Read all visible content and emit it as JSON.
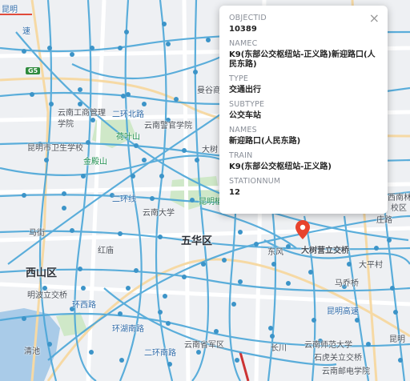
{
  "popup": {
    "close_label": "×",
    "fields": [
      {
        "name": "OBJECTID",
        "value": "10389"
      },
      {
        "name": "NAMEC",
        "value": "K9(东部公交枢纽站-正义路)新迎路口(人民东路)"
      },
      {
        "name": "TYPE",
        "value": "交通出行"
      },
      {
        "name": "SUBTYPE",
        "value": "公交车站"
      },
      {
        "name": "NAMES",
        "value": "新迎路口(人民东路)"
      },
      {
        "name": "TRAIN",
        "value": "K9(东部公交枢纽站-正义路)"
      },
      {
        "name": "STATIONNUM",
        "value": "12"
      }
    ]
  },
  "map": {
    "labels": {
      "l1": "昆明",
      "l2": "速",
      "l3": "G5",
      "l4": "云南工商管理",
      "l5": "学院",
      "l6": "二环北路",
      "l7": "云南警官学院",
      "l8": "曼谷商",
      "l9": "荷叶山",
      "l10": "昆明市卫生学校",
      "l11": "金殿山",
      "l12": "大树",
      "l13": "昆明植物园",
      "l14": "云南大学",
      "l15": "二环线",
      "l16": "马街",
      "l17": "红庙",
      "l18": "五华区",
      "l19": "西山区",
      "l20": "东风",
      "l21": "大树营立交桥",
      "l22": "大平村",
      "l23": "马乔桥",
      "l24": "明波立交桥",
      "l25": "环西路",
      "l26": "环湖南路",
      "l27": "清池",
      "l28": "云南省军区",
      "l29": "长川",
      "l30": "云南师范大学",
      "l31": "二环南路",
      "l32": "石虎关立交桥",
      "l33": "昆明",
      "l34": "云南邮电学院",
      "l35": "西南林",
      "l36": "校区",
      "l37": "庄路",
      "l38": "昆明高速"
    },
    "colors": {
      "route": "#4aa6d8",
      "stop": "#3c94c8",
      "marker": "#e8432e",
      "water": "#a9cbe8",
      "park": "#cfe8c8"
    },
    "marker_icon": "location-pin-icon"
  }
}
